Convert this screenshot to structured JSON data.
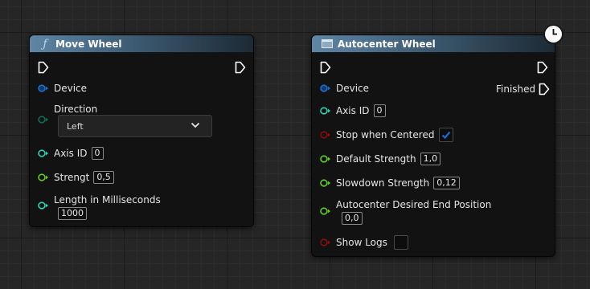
{
  "nodes": {
    "move_wheel": {
      "title": "Move Wheel",
      "icon": "function-icon",
      "pins": {
        "device": "Device",
        "direction": "Direction",
        "direction_value": "Left",
        "axis_id": "Axis ID",
        "axis_id_value": "0",
        "strength": "Strengt",
        "strength_value": "0,5",
        "length": "Length in Milliseconds",
        "length_value": "1000"
      }
    },
    "autocenter_wheel": {
      "title": "Autocenter Wheel",
      "icon": "macro-icon",
      "pins": {
        "device": "Device",
        "finished": "Finished",
        "axis_id": "Axis ID",
        "axis_id_value": "0",
        "stop_when_centered": "Stop when Centered",
        "stop_when_centered_checked": true,
        "default_strength": "Default Strength",
        "default_strength_value": "1,0",
        "slowdown_strength": "Slowdown Strength",
        "slowdown_strength_value": "0,12",
        "desired_end": "Autocenter Desired End Position",
        "desired_end_value": "0,0",
        "show_logs": "Show Logs",
        "show_logs_checked": false
      }
    }
  },
  "colors": {
    "exec": "#ffffff",
    "struct_pin": "#1f6fc4",
    "enum_pin": "#0f6a5a",
    "int_pin": "#2fd1b4",
    "float_pin": "#5fce2c",
    "bool_pin": "#8c0c0c",
    "checkbox_tick": "#1a6bd6"
  }
}
